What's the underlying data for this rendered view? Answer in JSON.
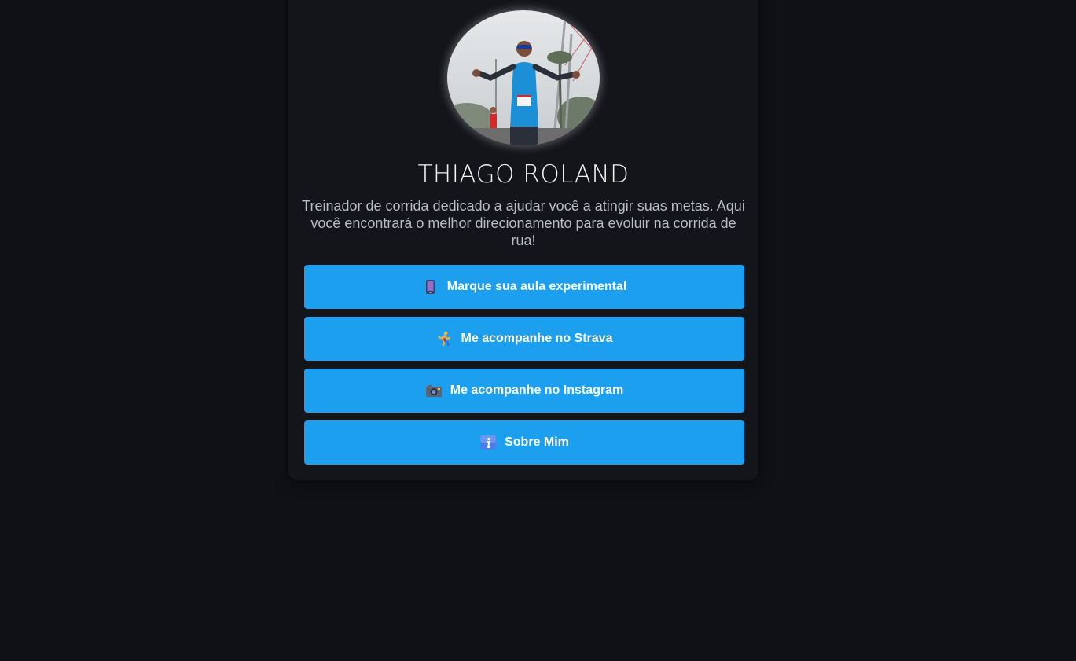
{
  "profile": {
    "name": "THIAGO ROLAND",
    "bio": "Treinador de corrida dedicado a ajudar você a atingir suas metas. Aqui você encontrará o melhor direcionamento para evoluir na corrida de rua!",
    "avatar_icon": "runner-photo"
  },
  "links": [
    {
      "label": "Marque sua aula experimental",
      "icon": "phone-icon"
    },
    {
      "label": "Me acompanhe no Strava",
      "icon": "runner-icon"
    },
    {
      "label": "Me acompanhe no Instagram",
      "icon": "camera-icon"
    },
    {
      "label": "Sobre Mim",
      "icon": "info-icon"
    }
  ],
  "colors": {
    "background": "#0f1117",
    "card": "#13151a",
    "button": "#1d9ff0",
    "button_text": "#ffffff"
  }
}
